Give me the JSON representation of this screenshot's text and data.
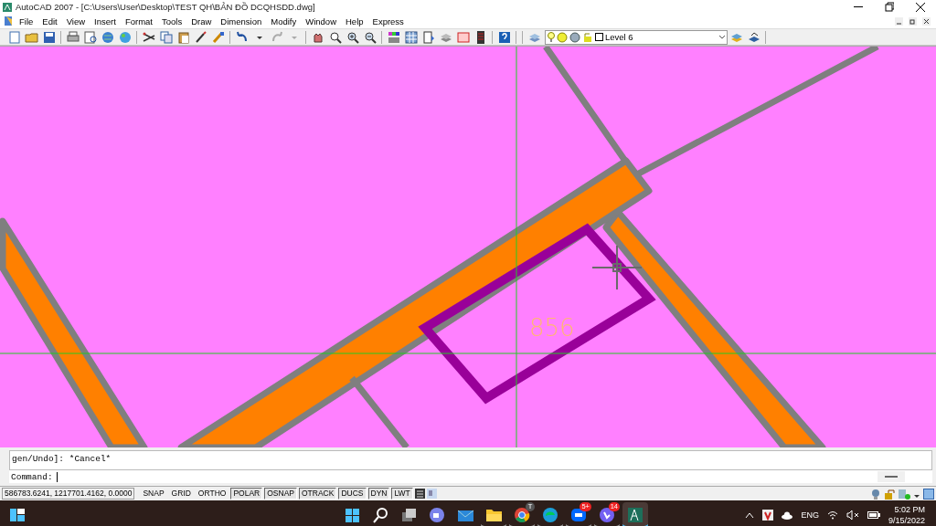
{
  "window": {
    "title": "AutoCAD 2007 - [C:\\Users\\User\\Desktop\\TEST QH\\BẢN ĐỒ DCQHSDD.dwg]"
  },
  "menu": [
    "File",
    "Edit",
    "View",
    "Insert",
    "Format",
    "Tools",
    "Draw",
    "Dimension",
    "Modify",
    "Window",
    "Help",
    "Express"
  ],
  "layer_dropdown": {
    "value": "Level 6"
  },
  "drawing": {
    "label": "856"
  },
  "command": {
    "history": [
      "gen/Undo]: *Cancel*"
    ],
    "prompt": "Command:"
  },
  "status_bar": {
    "coordinates": "586783.6241, 1217701.4162, 0.0000",
    "toggles": [
      {
        "label": "SNAP",
        "on": false
      },
      {
        "label": "GRID",
        "on": false
      },
      {
        "label": "ORTHO",
        "on": false
      },
      {
        "label": "POLAR",
        "on": true
      },
      {
        "label": "OSNAP",
        "on": true
      },
      {
        "label": "OTRACK",
        "on": true
      },
      {
        "label": "DUCS",
        "on": true
      },
      {
        "label": "DYN",
        "on": true
      },
      {
        "label": "LWT",
        "on": true
      }
    ]
  },
  "taskbar": {
    "apps": [
      {
        "kind": "start",
        "running": false,
        "selected": false
      },
      {
        "kind": "search",
        "running": false,
        "selected": false
      },
      {
        "kind": "taskview",
        "running": false,
        "selected": false
      },
      {
        "kind": "chat",
        "running": false,
        "selected": false
      },
      {
        "kind": "mail",
        "running": false,
        "selected": false
      },
      {
        "kind": "folder",
        "running": true,
        "selected": false
      },
      {
        "kind": "chrome",
        "running": true,
        "selected": false,
        "badge": "T"
      },
      {
        "kind": "edge",
        "running": true,
        "selected": false
      },
      {
        "kind": "zalo",
        "running": true,
        "selected": false,
        "badge": "5+"
      },
      {
        "kind": "viber",
        "running": true,
        "selected": false,
        "badge": "14"
      },
      {
        "kind": "autocad",
        "running": true,
        "selected": true
      }
    ],
    "language": "ENG",
    "time": "5:02 PM",
    "date": "9/15/2022"
  }
}
